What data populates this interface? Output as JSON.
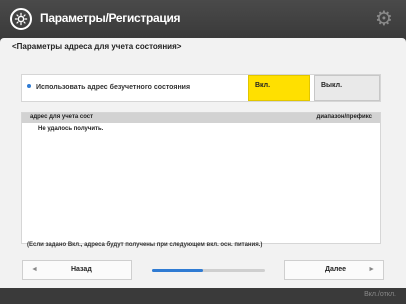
{
  "header": {
    "title": "Параметры/Регистрация",
    "app_icon": "settings-gear-circle-icon",
    "corner_icon": "gear-icon"
  },
  "page": {
    "subtitle": "<Параметры адреса для учета состояния>"
  },
  "setting": {
    "label": "Использовать адрес безучетного состояния",
    "on_label": "Вкл.",
    "off_label": "Выкл.",
    "selected": "on"
  },
  "list": {
    "col1": "адрес для учета сост",
    "col2": "диапазон/префикс",
    "message": "Не удалось получить."
  },
  "note": "(Если задано Вкл., адреса будут получены при следующем вкл. осн. питания.)",
  "nav": {
    "back_label": "Назад",
    "next_label": "Далее",
    "progress": 0.45
  },
  "footer": {
    "status": "Вкл./откл."
  },
  "colors": {
    "accent": "#ffe000",
    "progress": "#2f7bd3"
  }
}
